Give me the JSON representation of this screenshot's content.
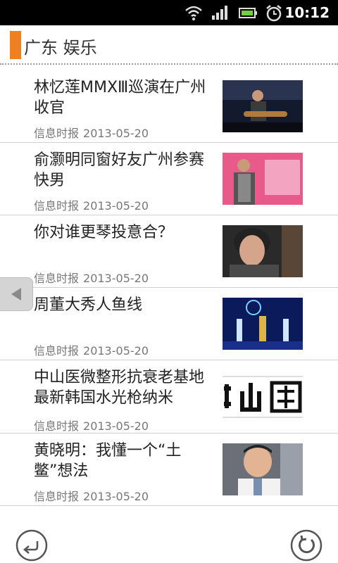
{
  "status_bar": {
    "time": "10:12",
    "icons": [
      "wifi-icon",
      "signal-icon",
      "battery-icon",
      "alarm-icon"
    ]
  },
  "header": {
    "title": "广东 娱乐",
    "accent_color": "#f07f1f"
  },
  "news": [
    {
      "title": "林忆莲MMXⅢ巡演在广州收官",
      "source": "信息时报",
      "date": "2013-05-20",
      "thumb": "singer-guitar-stage"
    },
    {
      "title": "俞灏明同窗好友广州参赛快男",
      "source": "信息时报",
      "date": "2013-05-20",
      "thumb": "contestant-pink-stage"
    },
    {
      "title": "你对谁更琴投意合？",
      "source": "信息时报",
      "date": "2013-05-20",
      "thumb": "woman-portrait"
    },
    {
      "title": "周董大秀人鱼线",
      "source": "信息时报",
      "date": "2013-05-20",
      "thumb": "dancers-blue-stage"
    },
    {
      "title": "中山医微整形抗衰老基地 最新韩国水光枪纳米",
      "source": "信息时报",
      "date": "2013-05-20",
      "thumb": "calligraphy-banner"
    },
    {
      "title": "黄晓明：我懂一个“土鳖”想法",
      "source": "信息时报",
      "date": "2013-05-20",
      "thumb": "actor-portrait"
    }
  ],
  "toolbar": {
    "back_icon": "back-arrow-icon",
    "refresh_icon": "refresh-icon"
  }
}
